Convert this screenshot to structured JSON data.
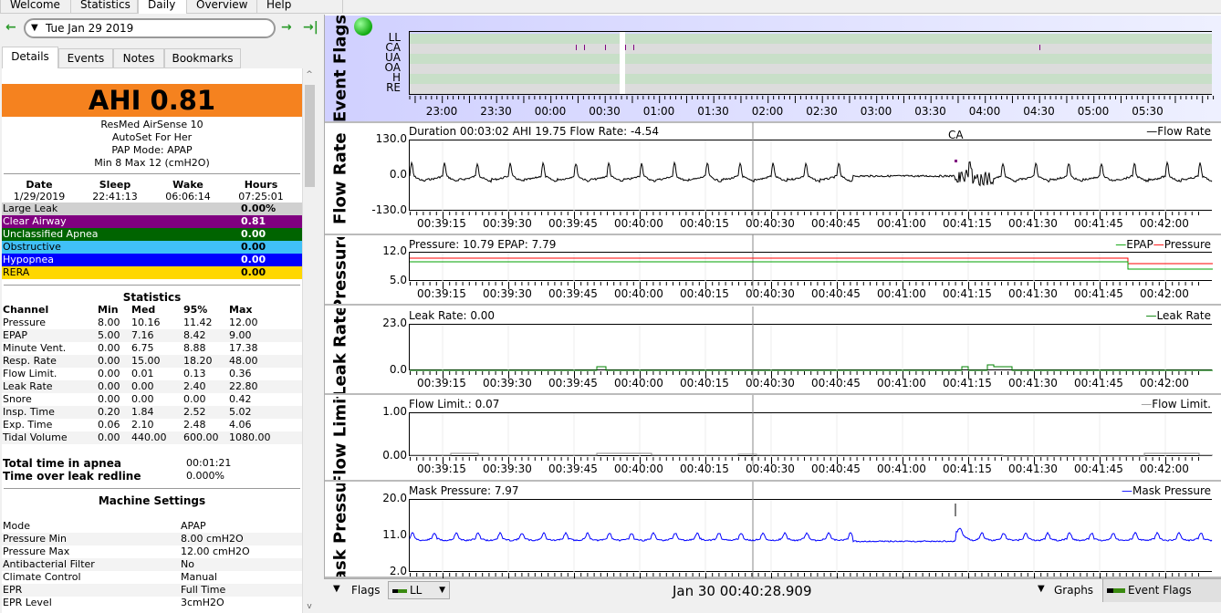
{
  "top_tabs": [
    "Welcome",
    "Statistics",
    "Daily",
    "Overview",
    "Help Browser"
  ],
  "active_tab": "Daily",
  "date_picker": {
    "value": "Tue Jan 29 2019"
  },
  "side_tabs": [
    "Details",
    "Events",
    "Notes",
    "Bookmarks"
  ],
  "ahi": "AHI 0.81",
  "device": [
    "ResMed AirSense 10",
    "AutoSet For Her",
    "PAP Mode: APAP",
    "Min 8 Max 12 (cmH2O)"
  ],
  "session": {
    "headers": [
      "Date",
      "Sleep",
      "Wake",
      "Hours"
    ],
    "values": [
      "1/29/2019",
      "22:41:13",
      "06:06:14",
      "07:25:01"
    ]
  },
  "events": [
    {
      "label": "Large Leak",
      "value": "0.00%",
      "bg": "#d0d0d0",
      "fg": "#000000"
    },
    {
      "label": "Clear Airway",
      "value": "0.81",
      "bg": "#800080",
      "fg": "#ffffff"
    },
    {
      "label": "Unclassified Apnea",
      "value": "0.00",
      "bg": "#006400",
      "fg": "#ffffff"
    },
    {
      "label": "Obstructive",
      "value": "0.00",
      "bg": "#40c0f8",
      "fg": "#000000"
    },
    {
      "label": "Hypopnea",
      "value": "0.00",
      "bg": "#0000ff",
      "fg": "#ffffff"
    },
    {
      "label": "RERA",
      "value": "0.00",
      "bg": "#ffd700",
      "fg": "#000000"
    }
  ],
  "statistics": {
    "title": "Statistics",
    "headers": [
      "Channel",
      "Min",
      "Med",
      "95%",
      "Max"
    ],
    "rows": [
      [
        "Pressure",
        "8.00",
        "10.16",
        "11.42",
        "12.00"
      ],
      [
        "EPAP",
        "5.00",
        "7.16",
        "8.42",
        "9.00"
      ],
      [
        "Minute Vent.",
        "0.00",
        "6.75",
        "8.88",
        "17.38"
      ],
      [
        "Resp. Rate",
        "0.00",
        "15.00",
        "18.20",
        "48.00"
      ],
      [
        "Flow Limit.",
        "0.00",
        "0.01",
        "0.13",
        "0.36"
      ],
      [
        "Leak Rate",
        "0.00",
        "0.00",
        "2.40",
        "22.80"
      ],
      [
        "Snore",
        "0.00",
        "0.00",
        "0.00",
        "0.42"
      ],
      [
        "Insp. Time",
        "0.20",
        "1.84",
        "2.52",
        "5.02"
      ],
      [
        "Exp. Time",
        "0.06",
        "2.10",
        "2.48",
        "4.06"
      ],
      [
        "Tidal Volume",
        "0.00",
        "440.00",
        "600.00",
        "1080.00"
      ]
    ]
  },
  "totals": [
    [
      "Total time in apnea",
      "00:01:21"
    ],
    [
      "Time over leak redline",
      "0.000%"
    ]
  ],
  "machine_settings": {
    "title": "Machine Settings",
    "rows": [
      [
        "Mode",
        "APAP"
      ],
      [
        "Pressure Min",
        "8.00 cmH2O"
      ],
      [
        "Pressure Max",
        "12.00 cmH2O"
      ],
      [
        "Antibacterial Filter",
        "No"
      ],
      [
        "Climate Control",
        "Manual"
      ],
      [
        "EPR",
        "Full Time"
      ],
      [
        "EPR Level",
        "3cmH2O"
      ]
    ]
  },
  "event_flags": {
    "title": "Event Flags",
    "rows": [
      "LL",
      "CA",
      "UA",
      "OA",
      "H",
      "RE"
    ],
    "times": [
      "23:00",
      "23:30",
      "00:00",
      "00:30",
      "01:00",
      "01:30",
      "02:00",
      "02:30",
      "03:00",
      "03:30",
      "04:00",
      "04:30",
      "05:00",
      "05:30"
    ]
  },
  "detail_times": [
    "00:39:15",
    "00:39:30",
    "00:39:45",
    "00:40:00",
    "00:40:15",
    "00:40:30",
    "00:40:45",
    "00:41:00",
    "00:41:15",
    "00:41:30",
    "00:41:45",
    "00:42:00"
  ],
  "graphs": [
    {
      "id": "flow",
      "title": "Flow Rate",
      "header": "Duration 00:03:02 AHI 19.75 Flow Rate: -4.54",
      "legend": "Flow Rate",
      "color": "#000000",
      "yticks": [
        "130.0",
        "0.0",
        "-130.0"
      ],
      "annotation": "CA"
    },
    {
      "id": "pressure",
      "title": "Pressure",
      "header": "Pressure: 10.79 EPAP: 7.79",
      "legend": [
        "EPAP",
        "Pressure"
      ],
      "colors": [
        "#00a000",
        "#ff0000"
      ],
      "yticks": [
        "12.0",
        "5.0"
      ]
    },
    {
      "id": "leak",
      "title": "Leak Rate",
      "header": "Leak Rate: 0.00",
      "legend": "Leak Rate",
      "color": "#008000",
      "yticks": [
        "23.0",
        "0.0"
      ]
    },
    {
      "id": "flowlimit",
      "title": "Flow Limit",
      "header": "Flow Limit.: 0.07",
      "legend": "Flow Limit.",
      "color": "#999999",
      "yticks": [
        "1.00",
        "0.00"
      ]
    },
    {
      "id": "mask",
      "title": "Mask Pressure",
      "header": "Mask Pressure: 7.97",
      "legend": "Mask Pressure",
      "color": "#0000ff",
      "yticks": [
        "20.0",
        "11.0",
        "2.0"
      ]
    }
  ],
  "bottom": {
    "flags_label": "Flags",
    "flags_select": "LL",
    "timestamp": "Jan 30 00:40:28.909",
    "graphs_label": "Graphs",
    "event_flags_label": "Event Flags"
  }
}
